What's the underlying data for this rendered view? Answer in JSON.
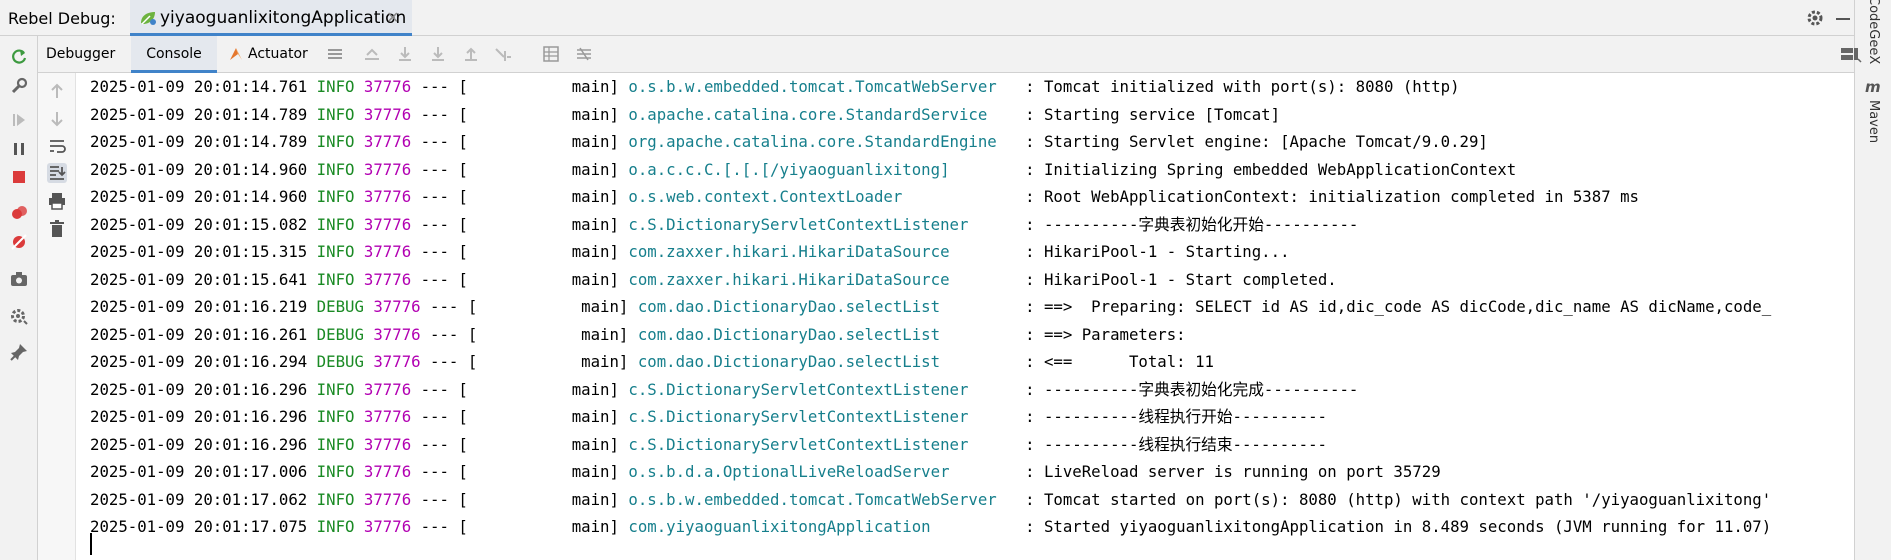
{
  "titlebar": {
    "run_label": "Rebel Debug:",
    "tab_title": "yiyaoguanlixitongApplication",
    "tab_close": "✕"
  },
  "right_stripe": {
    "codegeex": "CodeGeeX",
    "maven_m": "m",
    "maven": "Maven"
  },
  "subtabs": {
    "debugger": "Debugger",
    "console": "Console",
    "actuator": "Actuator"
  },
  "colors": {
    "accent": "#4083c9",
    "info": "#1a8a24",
    "pid": "#b200b2",
    "logger": "#167f8c"
  },
  "log": [
    {
      "time": "2025-01-09 20:01:14.761",
      "level": " INFO",
      "pid": "37776",
      "sep": " --- [           main] ",
      "logger": "o.s.b.w.embedded.tomcat.TomcatWebServer  ",
      "msg": " : Tomcat initialized with port(s): 8080 (http)"
    },
    {
      "time": "2025-01-09 20:01:14.789",
      "level": " INFO",
      "pid": "37776",
      "sep": " --- [           main] ",
      "logger": "o.apache.catalina.core.StandardService   ",
      "msg": " : Starting service [Tomcat]"
    },
    {
      "time": "2025-01-09 20:01:14.789",
      "level": " INFO",
      "pid": "37776",
      "sep": " --- [           main] ",
      "logger": "org.apache.catalina.core.StandardEngine  ",
      "msg": " : Starting Servlet engine: [Apache Tomcat/9.0.29]"
    },
    {
      "time": "2025-01-09 20:01:14.960",
      "level": " INFO",
      "pid": "37776",
      "sep": " --- [           main] ",
      "logger": "o.a.c.c.C.[.[.[/yiyaoguanlixitong]       ",
      "msg": " : Initializing Spring embedded WebApplicationContext"
    },
    {
      "time": "2025-01-09 20:01:14.960",
      "level": " INFO",
      "pid": "37776",
      "sep": " --- [           main] ",
      "logger": "o.s.web.context.ContextLoader            ",
      "msg": " : Root WebApplicationContext: initialization completed in 5387 ms"
    },
    {
      "time": "2025-01-09 20:01:15.082",
      "level": " INFO",
      "pid": "37776",
      "sep": " --- [           main] ",
      "logger": "c.S.DictionaryServletContextListener     ",
      "msg": " : ----------字典表初始化开始----------"
    },
    {
      "time": "2025-01-09 20:01:15.315",
      "level": " INFO",
      "pid": "37776",
      "sep": " --- [           main] ",
      "logger": "com.zaxxer.hikari.HikariDataSource       ",
      "msg": " : HikariPool-1 - Starting..."
    },
    {
      "time": "2025-01-09 20:01:15.641",
      "level": " INFO",
      "pid": "37776",
      "sep": " --- [           main] ",
      "logger": "com.zaxxer.hikari.HikariDataSource       ",
      "msg": " : HikariPool-1 - Start completed."
    },
    {
      "time": "2025-01-09 20:01:16.219",
      "level": " DEBUG",
      "pid": "37776",
      "sep": " --- [           main] ",
      "logger": "com.dao.DictionaryDao.selectList        ",
      "msg": " : ==>  Preparing: SELECT id AS id,dic_code AS dicCode,dic_name AS dicName,code_"
    },
    {
      "time": "2025-01-09 20:01:16.261",
      "level": " DEBUG",
      "pid": "37776",
      "sep": " --- [           main] ",
      "logger": "com.dao.DictionaryDao.selectList        ",
      "msg": " : ==> Parameters: "
    },
    {
      "time": "2025-01-09 20:01:16.294",
      "level": " DEBUG",
      "pid": "37776",
      "sep": " --- [           main] ",
      "logger": "com.dao.DictionaryDao.selectList        ",
      "msg": " : <==      Total: 11"
    },
    {
      "time": "2025-01-09 20:01:16.296",
      "level": " INFO",
      "pid": "37776",
      "sep": " --- [           main] ",
      "logger": "c.S.DictionaryServletContextListener     ",
      "msg": " : ----------字典表初始化完成----------"
    },
    {
      "time": "2025-01-09 20:01:16.296",
      "level": " INFO",
      "pid": "37776",
      "sep": " --- [           main] ",
      "logger": "c.S.DictionaryServletContextListener     ",
      "msg": " : ----------线程执行开始----------"
    },
    {
      "time": "2025-01-09 20:01:16.296",
      "level": " INFO",
      "pid": "37776",
      "sep": " --- [           main] ",
      "logger": "c.S.DictionaryServletContextListener     ",
      "msg": " : ----------线程执行结束----------"
    },
    {
      "time": "2025-01-09 20:01:17.006",
      "level": " INFO",
      "pid": "37776",
      "sep": " --- [           main] ",
      "logger": "o.s.b.d.a.OptionalLiveReloadServer       ",
      "msg": " : LiveReload server is running on port 35729"
    },
    {
      "time": "2025-01-09 20:01:17.062",
      "level": " INFO",
      "pid": "37776",
      "sep": " --- [           main] ",
      "logger": "o.s.b.w.embedded.tomcat.TomcatWebServer  ",
      "msg": " : Tomcat started on port(s): 8080 (http) with context path '/yiyaoguanlixitong'"
    },
    {
      "time": "2025-01-09 20:01:17.075",
      "level": " INFO",
      "pid": "37776",
      "sep": " --- [           main] ",
      "logger": "com.yiyaoguanlixitongApplication         ",
      "msg": " : Started yiyaoguanlixitongApplication in 8.489 seconds (JVM running for 11.07)"
    }
  ]
}
